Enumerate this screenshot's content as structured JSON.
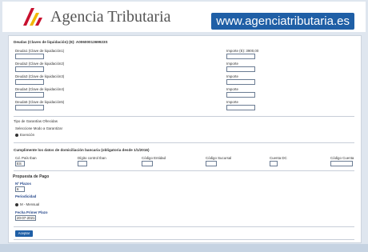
{
  "header": {
    "title": "Agencia Tributaria",
    "url": "www.agenciatributaria.es"
  },
  "deudas": {
    "heading": "Deudas (Claves de liquidación) (E): A0060001369923S",
    "rows": [
      {
        "label": "Deuda1 (Clave de liquidación1)",
        "importe_label": "Importe (E): 3900,00"
      },
      {
        "label": "Deuda2 (Clave de liquidación2)",
        "importe_label": "Importe"
      },
      {
        "label": "Deuda3 (Clave de liquidación3)",
        "importe_label": "Importe"
      },
      {
        "label": "Deuda4 (Clave de liquidación4)",
        "importe_label": "Importe"
      },
      {
        "label": "Deuda5 (Clave de liquidación5)",
        "importe_label": "Importe"
      }
    ]
  },
  "garantias": {
    "heading": "Tipo de Garantías Ofrecidas",
    "select_label": "Seleccione Modo a Garantizar",
    "option": "Exención"
  },
  "domiciliacion": {
    "heading": "Cumplimente los datos de domiciliación bancaria (obligatoria desde 1/1/2016)",
    "cols": [
      "Cd. País Iban",
      "Dígito control Iban",
      "Código Entidad",
      "Código Sucursal",
      "Cuenta DC",
      "Código Cuenta"
    ],
    "pais_value": "ES"
  },
  "propuesta": {
    "heading": "Propuesta de Pago",
    "plazos_label": "Nº Plazos",
    "plazos_value": "6",
    "periodicidad_label": "Periodicidad",
    "periodicidad_option": "M - Mensual",
    "fecha_label": "Fecha Primer Plazo",
    "fecha_value": "20-07-2021"
  },
  "actions": {
    "submit_label": "Aceptar"
  },
  "colors": {
    "brand_blue": "#1f5fa6",
    "logo_red": "#c8102e",
    "logo_yellow": "#f2b705"
  }
}
